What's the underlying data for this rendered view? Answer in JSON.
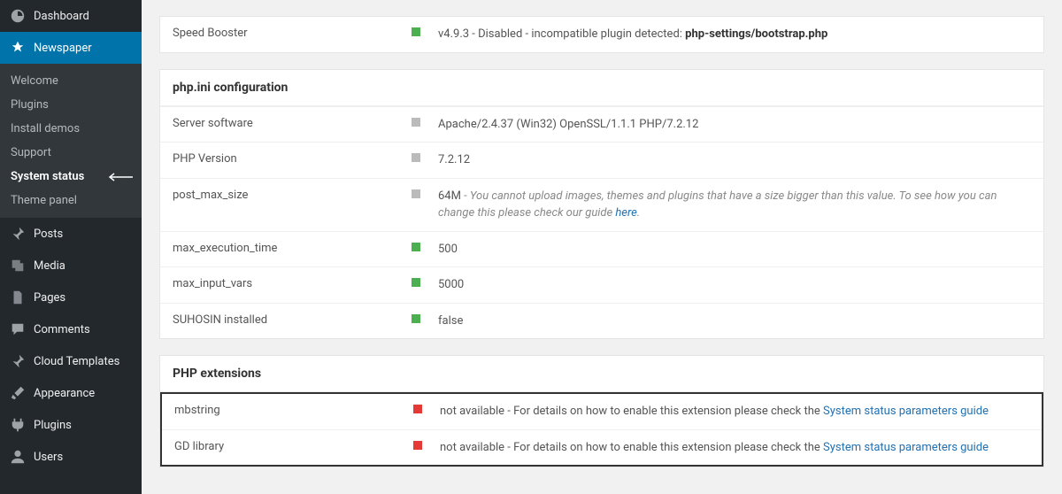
{
  "sidebar": {
    "main_items": [
      {
        "label": "Dashboard",
        "icon": "dashboard"
      },
      {
        "label": "Newspaper",
        "icon": "newspaper",
        "active": true
      }
    ],
    "submenu_items": [
      {
        "label": "Welcome"
      },
      {
        "label": "Plugins"
      },
      {
        "label": "Install demos"
      },
      {
        "label": "Support"
      },
      {
        "label": "System status",
        "current": true
      },
      {
        "label": "Theme panel"
      }
    ],
    "lower_items": [
      {
        "label": "Posts",
        "icon": "pin"
      },
      {
        "label": "Media",
        "icon": "media"
      },
      {
        "label": "Pages",
        "icon": "pages"
      },
      {
        "label": "Comments",
        "icon": "comment"
      },
      {
        "label": "Cloud Templates",
        "icon": "pin"
      },
      {
        "label": "Appearance",
        "icon": "brush"
      },
      {
        "label": "Plugins",
        "icon": "plugin"
      },
      {
        "label": "Users",
        "icon": "user"
      }
    ]
  },
  "top_panel": {
    "rows": [
      {
        "label": "Speed Booster",
        "status": "green",
        "value_prefix": "v4.9.3 - Disabled - incompatible plugin detected: ",
        "value_bold": "php-settings/bootstrap.php"
      }
    ]
  },
  "php_ini_panel": {
    "title": "php.ini configuration",
    "rows": [
      {
        "label": "Server software",
        "status": "gray",
        "value": "Apache/2.4.37 (Win32) OpenSSL/1.1.1 PHP/7.2.12"
      },
      {
        "label": "PHP Version",
        "status": "gray",
        "value": "7.2.12"
      },
      {
        "label": "post_max_size",
        "status": "gray",
        "value": "64M",
        "note_prefix": " - ",
        "note_italic": "You cannot upload images, themes and plugins that have a size bigger than this value. To see how you can change this please check our guide ",
        "note_link": "here",
        "note_suffix": "."
      },
      {
        "label": "max_execution_time",
        "status": "green",
        "value": "500"
      },
      {
        "label": "max_input_vars",
        "status": "green",
        "value": "5000"
      },
      {
        "label": "SUHOSIN installed",
        "status": "green",
        "value": "false"
      }
    ]
  },
  "php_ext_panel": {
    "title": "PHP extensions",
    "rows": [
      {
        "label": "mbstring",
        "status": "red",
        "value_prefix": "not available - For details on how to enable this extension please check the ",
        "value_link": "System status parameters guide"
      },
      {
        "label": "GD library",
        "status": "red",
        "value_prefix": "not available - For details on how to enable this extension please check the ",
        "value_link": "System status parameters guide"
      }
    ]
  }
}
